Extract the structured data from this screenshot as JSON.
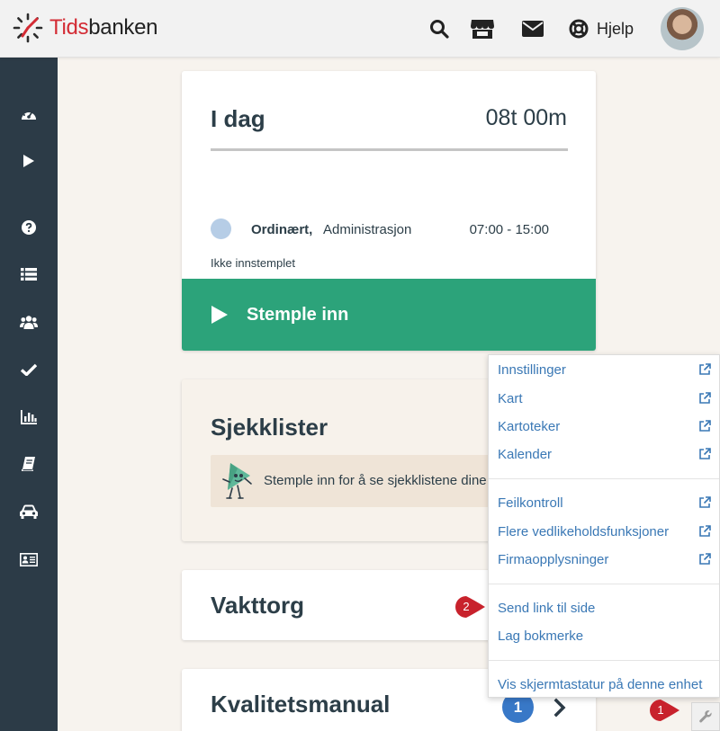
{
  "app": {
    "brand_prefix": "Tids",
    "brand_suffix": "banken"
  },
  "header": {
    "help_label": "Hjelp"
  },
  "today": {
    "title": "I dag",
    "hours": "08t 00m",
    "shift_type": "Ordinært,",
    "shift_department": "Administrasjon",
    "shift_time": "07:00 - 15:00",
    "stamp_status": "Ikke innstemplet",
    "stamp_button": "Stemple inn"
  },
  "checklists": {
    "title": "Sjekklister",
    "notice": "Stemple inn for å se sjekklistene dine"
  },
  "shift_market": {
    "title": "Vakttorg"
  },
  "quality_manual": {
    "title": "Kvalitetsmanual",
    "count": "1"
  },
  "tools_menu": {
    "items": [
      {
        "label": "Innstillinger"
      },
      {
        "label": "Kart"
      },
      {
        "label": "Kartoteker"
      },
      {
        "label": "Kalender"
      },
      {
        "label": "Feilkontroll"
      },
      {
        "label": "Flere vedlikeholdsfunksjoner"
      },
      {
        "label": "Firmaopplysninger"
      },
      {
        "label": "Send link til side"
      },
      {
        "label": "Lag bokmerke"
      },
      {
        "label": "Vis skjermtastatur på denne enhet"
      }
    ]
  },
  "callouts": {
    "one": "1",
    "two": "2"
  },
  "colors": {
    "sidebar": "#2c3b47",
    "primary_green": "#2ca37a",
    "brand_red": "#d32b34",
    "link_blue": "#3a78b5",
    "badge_blue": "#3878c7",
    "callout_red": "#c8222c"
  },
  "icons": {
    "header": [
      "search-icon",
      "store-icon",
      "mail-icon",
      "lifebuoy-icon"
    ],
    "sidebar": [
      "dashboard-icon",
      "play-icon",
      "help-icon",
      "list-icon",
      "users-icon",
      "check-icon",
      "chart-icon",
      "book-icon",
      "car-icon",
      "id-card-icon"
    ]
  }
}
